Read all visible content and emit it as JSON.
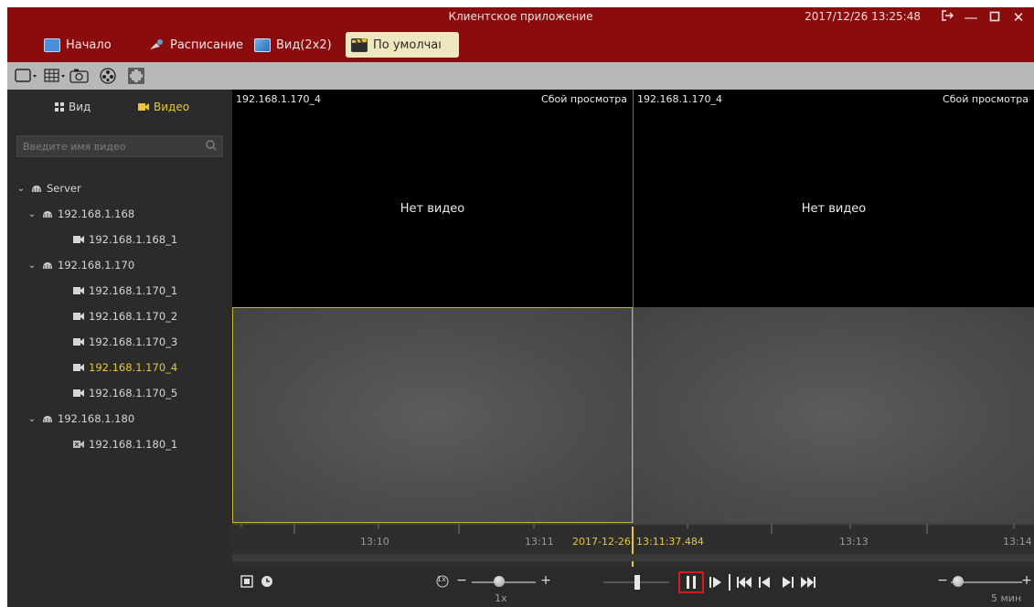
{
  "window": {
    "title": "Клиентское приложение",
    "datetime": "2017/12/26 13:25:48"
  },
  "menu": {
    "items": [
      {
        "label": "Начало",
        "icon": "monitor-icon"
      },
      {
        "label": "Расписание",
        "icon": "satellite-icon"
      },
      {
        "label": "Вид(2x2)",
        "icon": "grid-view-icon"
      },
      {
        "label": "По умолчаı",
        "icon": "clapperboard-icon",
        "active": true
      }
    ]
  },
  "sidebar": {
    "tabs": [
      {
        "label": "Вид",
        "icon": "grid-icon"
      },
      {
        "label": "Видео",
        "icon": "camera-icon",
        "active": true
      }
    ],
    "search_placeholder": "Введите имя видео",
    "tree": [
      {
        "label": "Server",
        "level": 0,
        "type": "server",
        "expanded": true
      },
      {
        "label": "192.168.1.168",
        "level": 1,
        "type": "device",
        "expanded": true
      },
      {
        "label": "192.168.1.168_1",
        "level": 2,
        "type": "camera"
      },
      {
        "label": "192.168.1.170",
        "level": 1,
        "type": "device",
        "expanded": true
      },
      {
        "label": "192.168.1.170_1",
        "level": 2,
        "type": "camera"
      },
      {
        "label": "192.168.1.170_2",
        "level": 2,
        "type": "camera"
      },
      {
        "label": "192.168.1.170_3",
        "level": 2,
        "type": "camera"
      },
      {
        "label": "192.168.1.170_4",
        "level": 2,
        "type": "camera",
        "selected": true
      },
      {
        "label": "192.168.1.170_5",
        "level": 2,
        "type": "camera"
      },
      {
        "label": "192.168.1.180",
        "level": 1,
        "type": "device",
        "expanded": true
      },
      {
        "label": "192.168.1.180_1",
        "level": 2,
        "type": "camera-offline"
      }
    ]
  },
  "grid": {
    "cells": [
      {
        "camera": "192.168.1.170_4",
        "status": "Сбой просмотра",
        "message": "Нет видео"
      },
      {
        "camera": "192.168.1.170_4",
        "status": "Сбой просмотра",
        "message": "Нет видео"
      },
      {
        "camera": "",
        "status": "",
        "message": ""
      },
      {
        "camera": "",
        "status": "",
        "message": ""
      }
    ]
  },
  "timeline": {
    "ticks": [
      "13:10",
      "13:11",
      "13:13",
      "13:14"
    ],
    "current_date": "2017-12-26",
    "current_time": "13:11:37.484"
  },
  "controls": {
    "speed_icon_label": "1x",
    "speed_value": "1x",
    "zoom_value": "5 мин",
    "minus": "−",
    "plus": "+"
  },
  "colors": {
    "brand": "#8a0c0c",
    "selected_text": "#e6c63b",
    "highlight_box": "#d61a1a"
  }
}
